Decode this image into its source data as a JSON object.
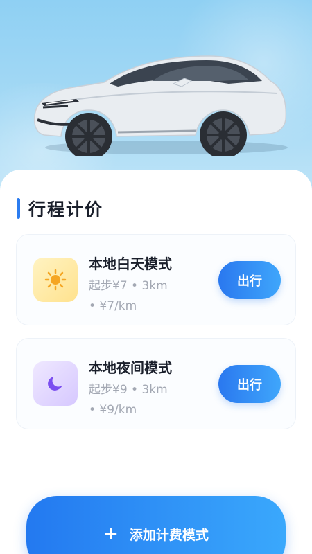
{
  "section": {
    "title": "行程计价"
  },
  "modes": [
    {
      "name": "本地白天模式",
      "desc_line1": "起步¥7 • 3km",
      "desc_line2": "• ¥7/km",
      "button": "出行",
      "icon": "sun-icon",
      "icon_color": "#f5a623"
    },
    {
      "name": "本地夜间模式",
      "desc_line1": "起步¥9 • 3km",
      "desc_line2": "• ¥9/km",
      "button": "出行",
      "icon": "moon-icon",
      "icon_color": "#7b4ef0"
    }
  ],
  "add_button": {
    "label": "添加计费模式",
    "icon": "plus-icon"
  },
  "colors": {
    "accent": "#2b7cf0",
    "hero_background": "#a7daf5",
    "title_text": "#1a1f2b",
    "secondary_text": "#a3a8b3"
  }
}
